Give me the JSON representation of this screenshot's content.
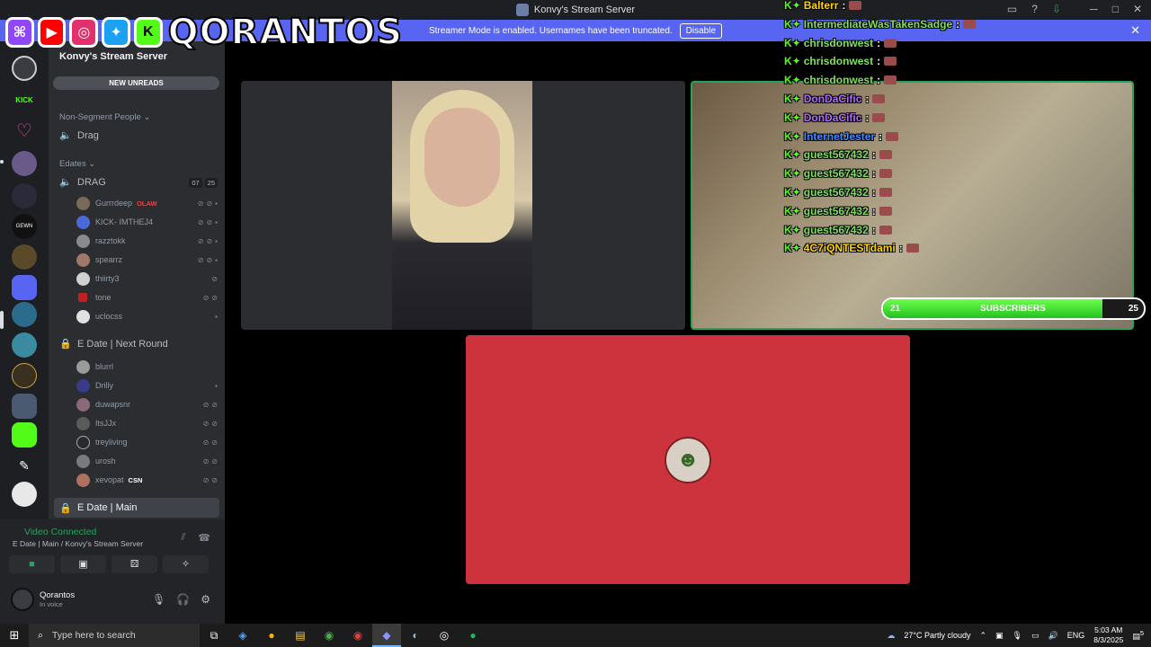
{
  "window": {
    "title": "Konvy's Stream Server"
  },
  "streamer_bar": {
    "text": "Streamer Mode is enabled. Usernames have been truncated.",
    "disable": "Disable"
  },
  "server": {
    "name": "Konvy's Stream Server",
    "new_unreads": "NEW UNREADS"
  },
  "categories": {
    "non_segment": "Non-Segment People",
    "edates": "Edates"
  },
  "channels": {
    "drag": "Drag",
    "drag_voice": "DRAG",
    "drag_badge": [
      "07",
      "25"
    ],
    "next_round": "E Date | Next Round",
    "main": "E Date | Main"
  },
  "drag_users": [
    {
      "name": "Gurrrdeep",
      "tag": "OLAW"
    },
    {
      "name": "KICK- IMTHEJ4",
      "tag": ""
    },
    {
      "name": "razztokk",
      "tag": ""
    },
    {
      "name": "spearrz",
      "tag": ""
    },
    {
      "name": "thiirty3",
      "tag": ""
    },
    {
      "name": "tone",
      "tag": ""
    },
    {
      "name": "uclocss",
      "tag": ""
    }
  ],
  "next_round_users": [
    {
      "name": "blurrl",
      "tag": ""
    },
    {
      "name": "Drilly",
      "tag": ""
    },
    {
      "name": "duwapsnr",
      "tag": ""
    },
    {
      "name": "ItsJJx",
      "tag": ""
    },
    {
      "name": "treyliving",
      "tag": ""
    },
    {
      "name": "urosh",
      "tag": ""
    },
    {
      "name": "xevopat",
      "tag": "CSN"
    }
  ],
  "voice": {
    "status": "Video Connected",
    "location": "E Date | Main / Konvy's Stream Server"
  },
  "me": {
    "name": "Qorantos",
    "status": "In voice"
  },
  "overlay": {
    "brand": "QORANTOS"
  },
  "chat": [
    {
      "user": "Balterr",
      "color": "#ffd400"
    },
    {
      "user": "IntermediateWasTakenSadge",
      "color": "#7ee05a"
    },
    {
      "user": "chrisdonwest",
      "color": "#7ee05a"
    },
    {
      "user": "chrisdonwest",
      "color": "#7ee05a"
    },
    {
      "user": "chrisdonwest",
      "color": "#7ee05a"
    },
    {
      "user": "DonDaCific",
      "color": "#b36bff"
    },
    {
      "user": "DonDaCific",
      "color": "#b36bff"
    },
    {
      "user": "InternetJester",
      "color": "#3d8bff"
    },
    {
      "user": "guest567432",
      "color": "#7ee05a"
    },
    {
      "user": "guest567432",
      "color": "#7ee05a"
    },
    {
      "user": "guest567432",
      "color": "#7ee05a"
    },
    {
      "user": "guest567432",
      "color": "#7ee05a"
    },
    {
      "user": "guest567432",
      "color": "#7ee05a"
    },
    {
      "user": "4C7iQNTESTdami",
      "color": "#ffd400"
    }
  ],
  "subscribers": {
    "label": "SUBSCRIBERS",
    "current": "21",
    "goal": "25",
    "progress": 0.84
  },
  "taskbar": {
    "search_placeholder": "Type here to search",
    "weather": "27°C  Partly cloudy",
    "lang": "ENG",
    "time": "5:03 AM",
    "date": "8/3/2025",
    "notif": "5"
  },
  "colors": {
    "accent": "#5865f2",
    "voice_green": "#23a55a",
    "subbar_green": "#24c022"
  }
}
